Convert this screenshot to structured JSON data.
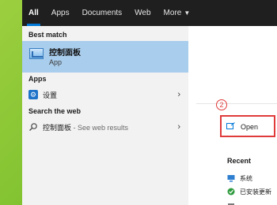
{
  "tabs": [
    {
      "label": "All",
      "active": true
    },
    {
      "label": "Apps",
      "active": false
    },
    {
      "label": "Documents",
      "active": false
    },
    {
      "label": "Web",
      "active": false
    },
    {
      "label": "More",
      "active": false
    }
  ],
  "best_match": {
    "heading": "Best match",
    "title": "控制面板",
    "subtitle": "App",
    "icon": "control-panel-icon"
  },
  "apps": {
    "heading": "Apps",
    "items": [
      {
        "label": "设置",
        "icon": "gear-icon"
      }
    ]
  },
  "web": {
    "heading": "Search the web",
    "items": [
      {
        "label": "控制面板",
        "suffix": " - See web results",
        "icon": "search-icon"
      }
    ]
  },
  "detail": {
    "step_number": "2",
    "open_label": "Open",
    "recent_heading": "Recent",
    "recent_items": [
      {
        "label": "系统",
        "icon": "system-icon"
      },
      {
        "label": "已安装更新",
        "icon": "update-icon"
      }
    ]
  },
  "colors": {
    "accent": "#0078d7",
    "highlight": "#a9cdec",
    "annotation_red": "#e03a3a"
  }
}
